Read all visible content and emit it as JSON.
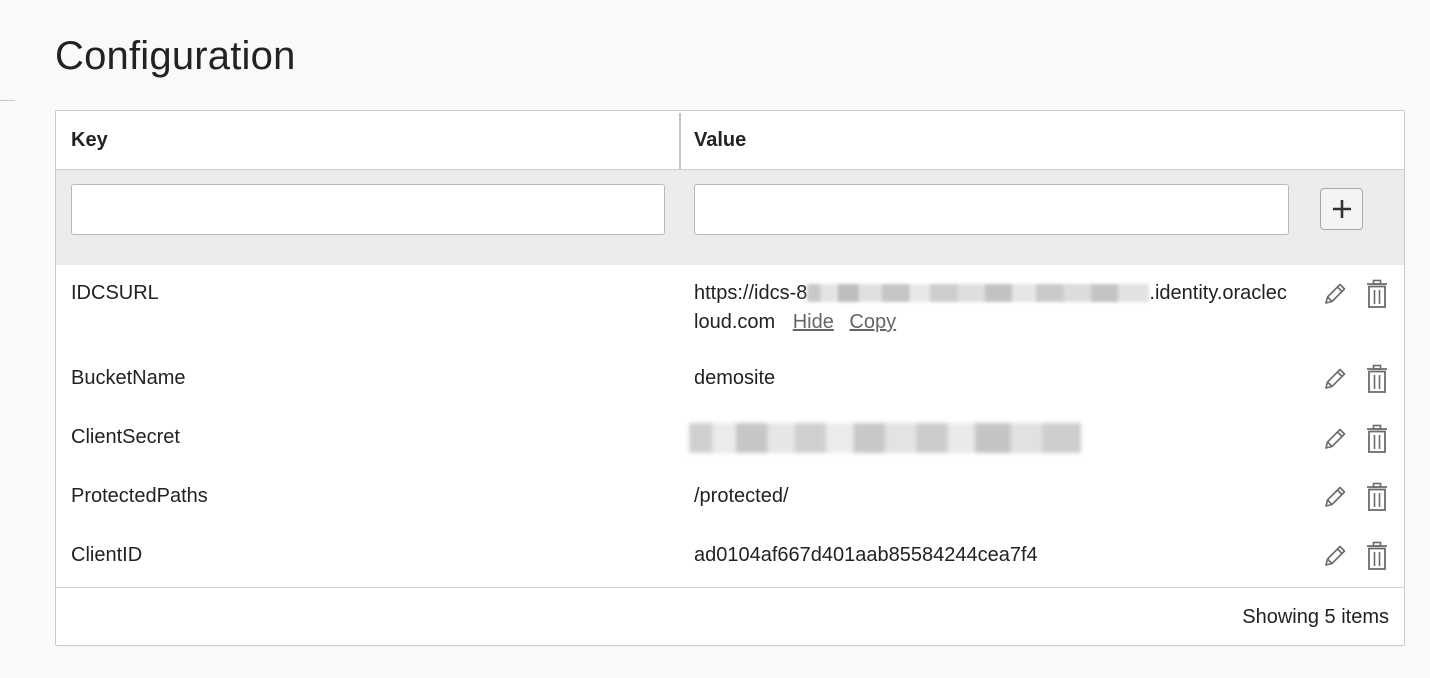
{
  "page": {
    "title": "Configuration"
  },
  "table": {
    "headers": {
      "key": "Key",
      "value": "Value"
    },
    "new_row": {
      "key_value": "",
      "value_value": ""
    },
    "rows": [
      {
        "key": "IDCSURL",
        "value_prefix": "https://idcs-8",
        "value_suffix": ".identity.oraclec",
        "value_line2": "loud.com",
        "hide_label": "Hide",
        "copy_label": "Copy"
      },
      {
        "key": "BucketName",
        "value": "demosite"
      },
      {
        "key": "ClientSecret",
        "value": ""
      },
      {
        "key": "ProtectedPaths",
        "value": "/protected/"
      },
      {
        "key": "ClientID",
        "value": "ad0104af667d401aab85584244cea7f4"
      }
    ],
    "footer": {
      "count_text": "Showing 5 items"
    }
  },
  "icons": {
    "add": "plus-icon",
    "edit": "pencil-icon",
    "delete": "trash-icon"
  },
  "colors": {
    "border": "#c9c9c9",
    "new_row_bg": "#ececec",
    "link": "#666666",
    "icon": "#6b6b6b"
  }
}
